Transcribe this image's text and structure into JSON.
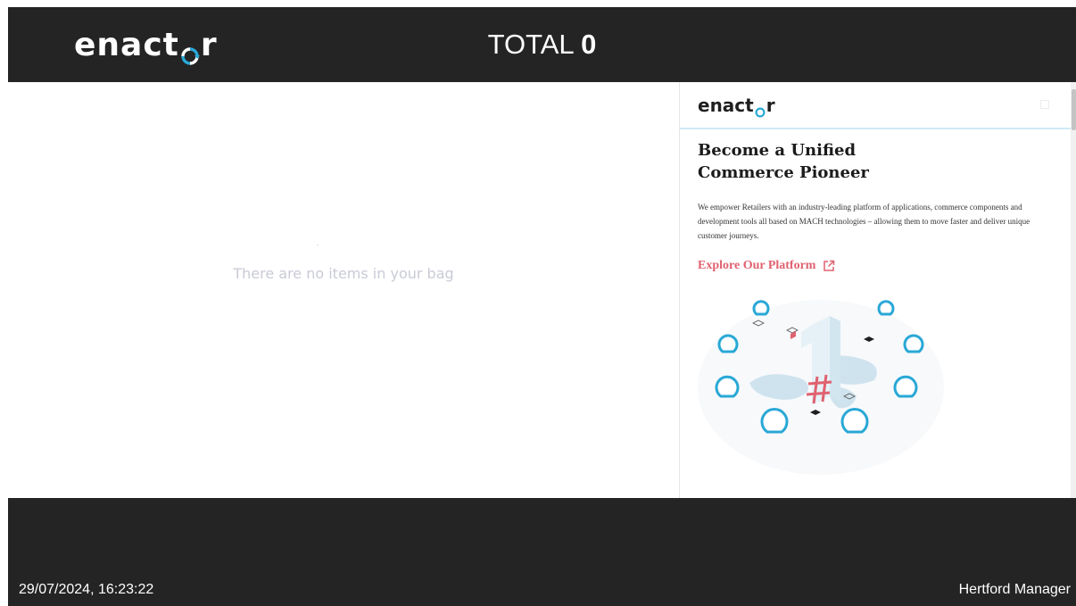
{
  "header": {
    "logo_text_start": "enact",
    "logo_text_end": "r",
    "total_label": "TOTAL",
    "total_value": "0"
  },
  "bag": {
    "empty_message": "There are no items in your bag"
  },
  "promo": {
    "logo_text_start": "enact",
    "logo_text_end": "r",
    "title_line1": "Become a Unified",
    "title_line2": "Commerce Pioneer",
    "body": "We empower Retailers with an industry-leading platform of applications, commerce components and development tools all based on MACH technologies – allowing them to move faster and deliver unique customer journeys.",
    "cta": "Explore Our Platform"
  },
  "footer": {
    "datetime": "29/07/2024, 16:23:22",
    "user": "Hertford Manager"
  },
  "colors": {
    "bar_background": "#242424",
    "accent_blue": "#29a8d6",
    "cta_pink": "#e0616f"
  },
  "icons": {
    "logo": "enactor-logo",
    "external_link": "external-link-icon"
  }
}
